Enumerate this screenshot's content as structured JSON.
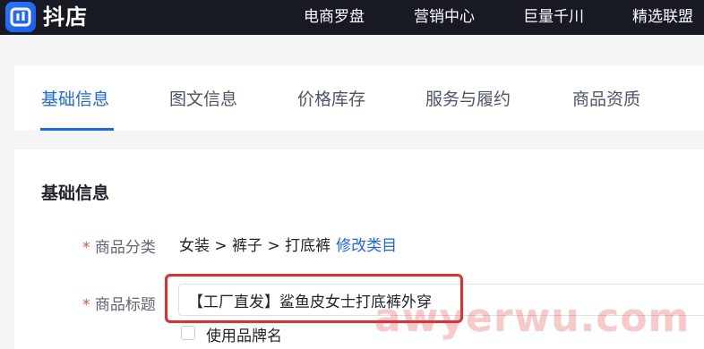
{
  "brand": {
    "logo_text": "抖店",
    "color": "#1966ff"
  },
  "topnav": {
    "items": [
      "电商罗盘",
      "营销中心",
      "巨量千川",
      "精选联盟"
    ]
  },
  "tabs": [
    {
      "label": "基础信息",
      "active": true
    },
    {
      "label": "图文信息",
      "active": false
    },
    {
      "label": "价格库存",
      "active": false
    },
    {
      "label": "服务与履约",
      "active": false
    },
    {
      "label": "商品资质",
      "active": false
    }
  ],
  "form": {
    "section_title": "基础信息",
    "required_mark": "*",
    "category": {
      "label": "商品分类",
      "path": "女装 > 裤子 > 打底裤",
      "modify_label": "修改类目"
    },
    "title": {
      "label": "商品标题",
      "value": "【工厂直发】鲨鱼皮女士打底裤外穿"
    },
    "brand_checkbox": {
      "label": "使用品牌名",
      "checked": false
    }
  },
  "watermark": "awyerwu.com",
  "colors": {
    "topbar": "#171a22",
    "accent": "#1966ff",
    "highlight": "#e52d2d",
    "required": "#f54a45"
  }
}
